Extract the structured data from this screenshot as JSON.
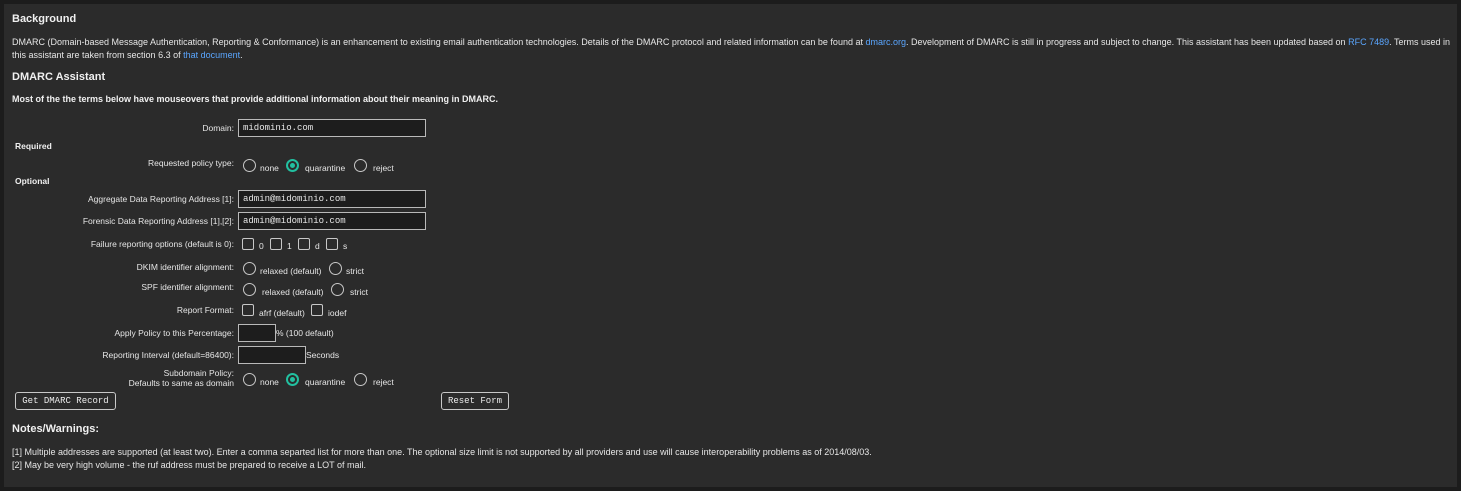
{
  "background": {
    "heading": "Background",
    "p1_a": "DMARC (Domain-based Message Authentication, Reporting & Conformance) is an enhancement to existing email authentication technologies. Details of the DMARC protocol and related information can be found at ",
    "link_dmarc": "dmarc.org",
    "p1_b": ". Development of DMARC is still in progress and subject to change. This assistant has been updated based on ",
    "link_rfc": "RFC 7489",
    "p1_c": ". Terms used in this assistant are taken from section 6.3 of ",
    "link_doc": "that document",
    "p1_d": "."
  },
  "assistant": {
    "heading": "DMARC Assistant",
    "intro": "Most of the the terms below have mouseovers that provide additional information about their meaning in DMARC."
  },
  "form": {
    "domain_label": "Domain:",
    "domain_value": "midominio.com",
    "required_label": "Required",
    "policy_label": "Requested policy type:",
    "policy_options": [
      "none",
      "quarantine",
      "reject"
    ],
    "policy_selected": "quarantine",
    "optional_label": "Optional",
    "rua_label": "Aggregate Data Reporting Address [1]:",
    "rua_value": "admin@midominio.com",
    "ruf_label": "Forensic Data Reporting Address [1],[2]:",
    "ruf_value": "admin@midominio.com",
    "fo_label": "Failure reporting options (default is 0):",
    "fo_options": [
      "0",
      "1",
      "d",
      "s"
    ],
    "dkim_label": "DKIM identifier alignment:",
    "spf_label": "SPF identifier alignment:",
    "alignment_options": [
      "relaxed (default)",
      "strict"
    ],
    "format_label": "Report Format:",
    "format_options": [
      "afrf (default)",
      "iodef"
    ],
    "pct_label": "Apply Policy to this Percentage:",
    "pct_value": "",
    "pct_suffix": "% (100 default)",
    "ri_label": "Reporting Interval (default=86400):",
    "ri_value": "",
    "ri_suffix": "Seconds",
    "sp_label_line1": "Subdomain Policy:",
    "sp_label_line2": "Defaults to same as domain",
    "sp_options": [
      "none",
      "quarantine",
      "reject"
    ],
    "sp_selected": "quarantine",
    "get_button": "Get DMARC Record",
    "reset_button": "Reset Form"
  },
  "notes": {
    "heading": "Notes/Warnings:",
    "note1": "[1] Multiple addresses are supported (at least two). Enter a comma separted list for more than one. The optional size limit is not supported by all providers and use will cause interoperability problems as of 2014/08/03.",
    "note2": "[2] May be very high volume - the ruf address must be prepared to receive a LOT of mail."
  },
  "colors": {
    "background": "#2b2b2b",
    "link": "#5aa6ff",
    "radio_selected": "#22c0a0"
  }
}
